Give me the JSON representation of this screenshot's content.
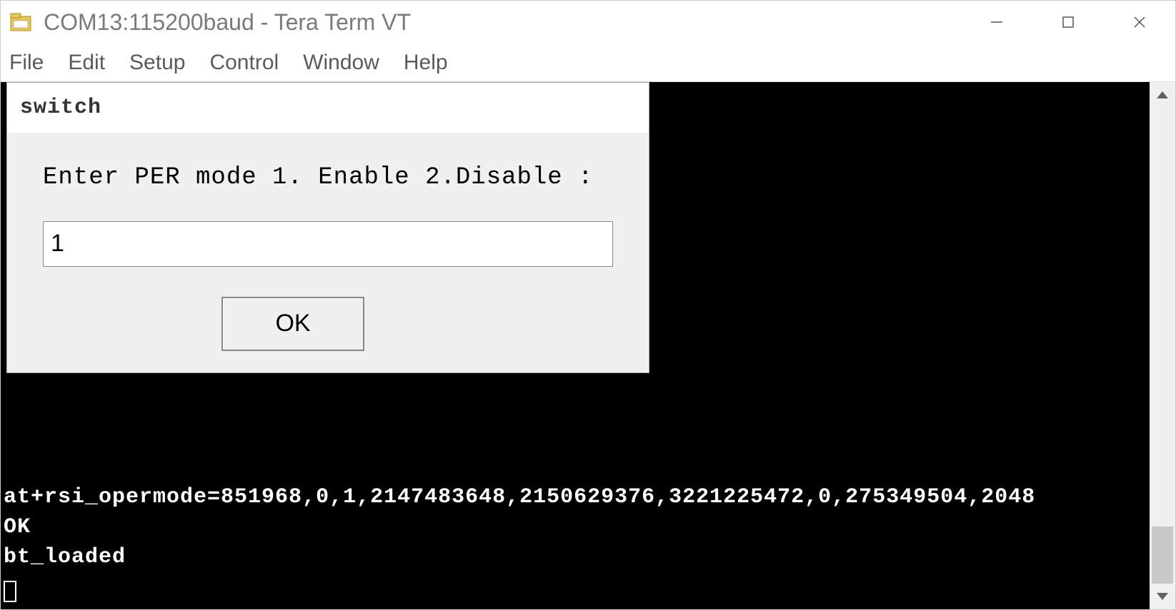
{
  "window": {
    "title": "COM13:115200baud - Tera Term VT"
  },
  "menubar": {
    "items": [
      "File",
      "Edit",
      "Setup",
      "Control",
      "Window",
      "Help"
    ]
  },
  "terminal": {
    "lines": [
      "at+rsi_opermode=851968,0,1,2147483648,2150629376,3221225472,0,275349504,2048",
      "OK",
      "bt_loaded"
    ]
  },
  "dialog": {
    "title": "switch",
    "prompt": "Enter PER mode 1. Enable 2.Disable :",
    "input_value": "1",
    "ok_label": "OK"
  }
}
